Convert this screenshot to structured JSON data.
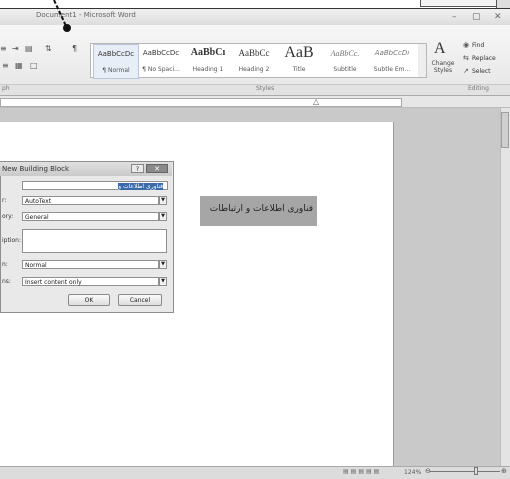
{
  "window": {
    "title": "Document1 - Microsoft Word",
    "minimize_icon": "minimize-icon",
    "restore_icon": "restore-icon",
    "close_icon": "close-icon"
  },
  "ribbon": {
    "paragraph_glyphs": [
      "¶"
    ],
    "styles": [
      {
        "sample": "AaBbCcDc",
        "name": "¶ Normal"
      },
      {
        "sample": "AaBbCcDc",
        "name": "¶ No Spaci..."
      },
      {
        "sample": "AaBbCı",
        "name": "Heading 1"
      },
      {
        "sample": "AaBbCc",
        "name": "Heading 2"
      },
      {
        "sample": "AaB",
        "name": "Title"
      },
      {
        "sample": "AaBbCc.",
        "name": "Subtitle"
      },
      {
        "sample": "AaBbCcDı",
        "name": "Subtle Em..."
      }
    ],
    "change_styles": "Change\nStyles",
    "find": "Find",
    "replace": "Replace",
    "select": "Select",
    "group_labels": {
      "paragraph": "ph",
      "styles": "Styles",
      "editing": "Editing"
    }
  },
  "document": {
    "selected_text": "فناوری اطلاعات و ارتباطات"
  },
  "dialog": {
    "title": "New Building Block",
    "help_label": "?",
    "close_label": "✕",
    "fields": {
      "name_value": "فناوری اطلاعات و",
      "gallery_label": "r:",
      "gallery_value": "AutoText",
      "category_label": "ory:",
      "category_value": "General",
      "description_label": "iption:",
      "description_value": "",
      "save_in_label": "n:",
      "save_in_value": "Normal",
      "options_label": "ns:",
      "options_value": "Insert content only"
    },
    "ok_label": "OK",
    "cancel_label": "Cancel"
  },
  "statusbar": {
    "zoom": "124%"
  }
}
